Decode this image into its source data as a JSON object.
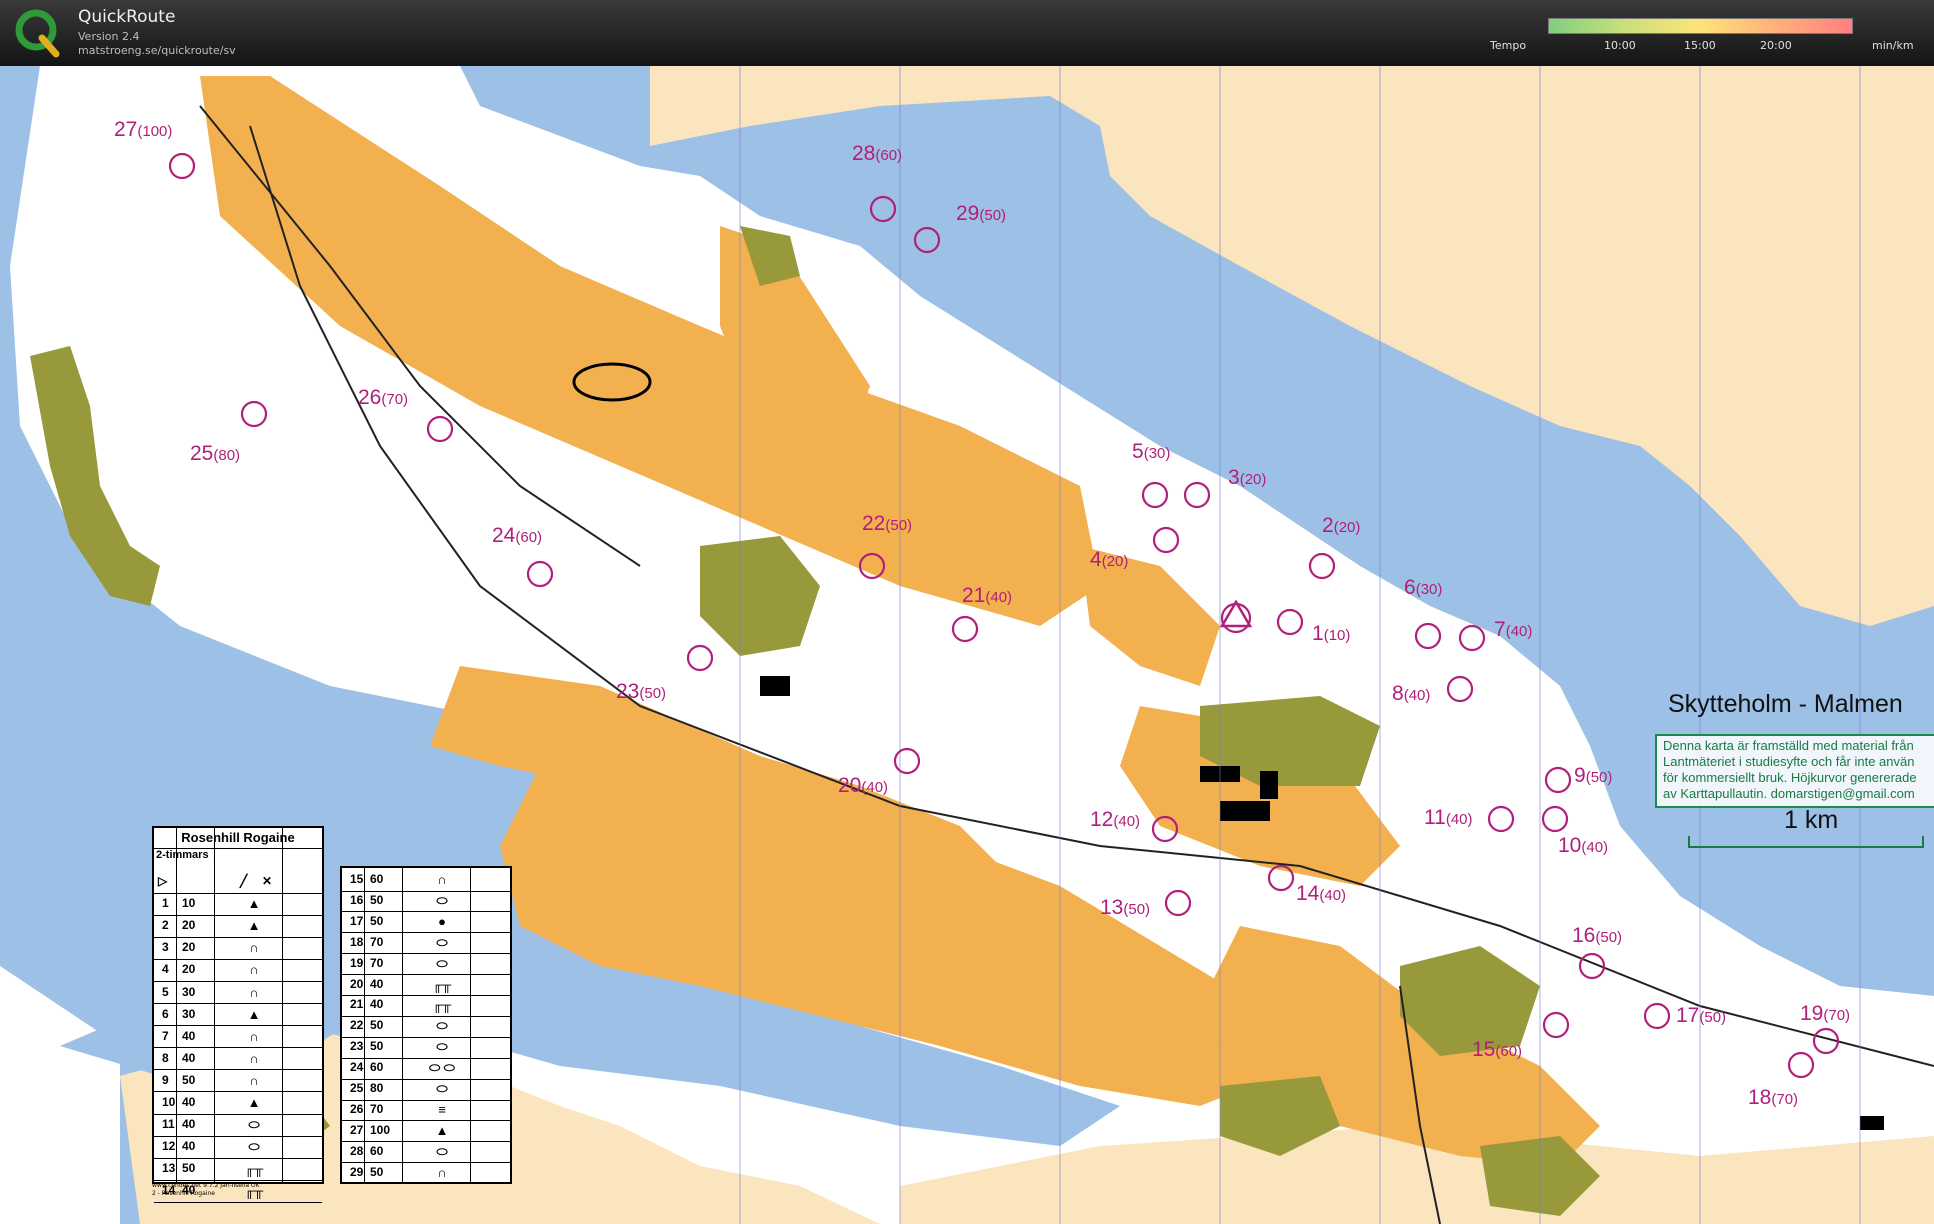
{
  "app": {
    "title": "QuickRoute",
    "version": "Version 2.4",
    "url": "matstroeng.se/quickroute/sv"
  },
  "tempo_legend": {
    "label": "Tempo",
    "ticks": [
      "10:00",
      "15:00",
      "20:00"
    ],
    "unit": "min/km",
    "colors": [
      "#7fcf7f",
      "#c9e07a",
      "#ffe27a",
      "#ffb07a",
      "#ff7f7f"
    ]
  },
  "map": {
    "title": "Skytteholm - Malmen",
    "info_lines": [
      "Denna karta är framställd med material från",
      "Lantmäteriet i studiesyfte och får inte använ",
      "för kommersiellt bruk. Höjkurvor genererade",
      "av Karttapullautin. domarstigen@gmail.com"
    ],
    "scale_label": "1 km",
    "colors": {
      "water": "#9cc0e6",
      "open": "#f7c988",
      "rough": "#fbe5bf",
      "forest": "#ffffff",
      "settlement": "#97993a",
      "field": "#f3b04f",
      "control": "#b0207a",
      "contour": "#c97a3a"
    }
  },
  "controls": [
    {
      "num": "1",
      "pts": "10"
    },
    {
      "num": "2",
      "pts": "20"
    },
    {
      "num": "3",
      "pts": "20"
    },
    {
      "num": "4",
      "pts": "20"
    },
    {
      "num": "5",
      "pts": "30"
    },
    {
      "num": "6",
      "pts": "30"
    },
    {
      "num": "7",
      "pts": "40"
    },
    {
      "num": "8",
      "pts": "40"
    },
    {
      "num": "9",
      "pts": "50"
    },
    {
      "num": "10",
      "pts": "40"
    },
    {
      "num": "11",
      "pts": "40"
    },
    {
      "num": "12",
      "pts": "40"
    },
    {
      "num": "13",
      "pts": "50"
    },
    {
      "num": "14",
      "pts": "40"
    },
    {
      "num": "15",
      "pts": "60"
    },
    {
      "num": "16",
      "pts": "50"
    },
    {
      "num": "17",
      "pts": "50"
    },
    {
      "num": "18",
      "pts": "70"
    },
    {
      "num": "19",
      "pts": "70"
    },
    {
      "num": "20",
      "pts": "40"
    },
    {
      "num": "21",
      "pts": "40"
    },
    {
      "num": "22",
      "pts": "50"
    },
    {
      "num": "23",
      "pts": "50"
    },
    {
      "num": "24",
      "pts": "60"
    },
    {
      "num": "25",
      "pts": "80"
    },
    {
      "num": "26",
      "pts": "70"
    },
    {
      "num": "27",
      "pts": "100"
    },
    {
      "num": "28",
      "pts": "60"
    },
    {
      "num": "29",
      "pts": "50"
    }
  ],
  "description_sheet": {
    "title": "Rosenhill Rogaine",
    "subtitle": "2-timmars",
    "header_symbols": [
      "▷",
      "╱",
      "✕"
    ],
    "rows_left": [
      {
        "num": "1",
        "pts": "10",
        "symbol": "▲"
      },
      {
        "num": "2",
        "pts": "20",
        "symbol": "▲"
      },
      {
        "num": "3",
        "pts": "20",
        "symbol": "∩"
      },
      {
        "num": "4",
        "pts": "20",
        "symbol": "∩"
      },
      {
        "num": "5",
        "pts": "30",
        "symbol": "∩"
      },
      {
        "num": "6",
        "pts": "30",
        "symbol": "▲"
      },
      {
        "num": "7",
        "pts": "40",
        "symbol": "∩"
      },
      {
        "num": "8",
        "pts": "40",
        "symbol": "∩"
      },
      {
        "num": "9",
        "pts": "50",
        "symbol": "∩"
      },
      {
        "num": "10",
        "pts": "40",
        "symbol": "▲"
      },
      {
        "num": "11",
        "pts": "40",
        "symbol": "⬭"
      },
      {
        "num": "12",
        "pts": "40",
        "symbol": "⬭"
      },
      {
        "num": "13",
        "pts": "50",
        "symbol": "╓╥"
      },
      {
        "num": "14",
        "pts": "40",
        "symbol": "╓╥"
      }
    ],
    "rows_right": [
      {
        "num": "15",
        "pts": "60",
        "symbol": "∩"
      },
      {
        "num": "16",
        "pts": "50",
        "symbol": "⬭"
      },
      {
        "num": "17",
        "pts": "50",
        "symbol": "●"
      },
      {
        "num": "18",
        "pts": "70",
        "symbol": "⬭"
      },
      {
        "num": "19",
        "pts": "70",
        "symbol": "⬭"
      },
      {
        "num": "20",
        "pts": "40",
        "symbol": "╓╥"
      },
      {
        "num": "21",
        "pts": "40",
        "symbol": "╓╥"
      },
      {
        "num": "22",
        "pts": "50",
        "symbol": "⬭"
      },
      {
        "num": "23",
        "pts": "50",
        "symbol": "⬭"
      },
      {
        "num": "24",
        "pts": "60",
        "symbol": "⬭ ⬭"
      },
      {
        "num": "25",
        "pts": "80",
        "symbol": "⬭"
      },
      {
        "num": "26",
        "pts": "70",
        "symbol": "≡"
      },
      {
        "num": "27",
        "pts": "100",
        "symbol": "▲"
      },
      {
        "num": "28",
        "pts": "60",
        "symbol": "⬭"
      },
      {
        "num": "29",
        "pts": "50",
        "symbol": "∩"
      }
    ],
    "footer_lines": [
      "www.condes.net 9.7.2 Jan-Ilsella OK",
      "2 - Rosenhill Rogaine"
    ]
  }
}
